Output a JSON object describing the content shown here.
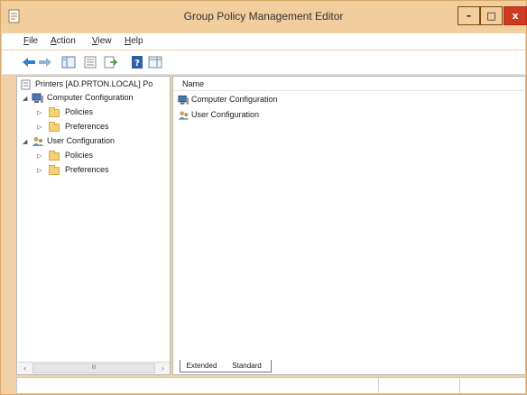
{
  "window": {
    "title": "Group Policy Management Editor",
    "controls": {
      "minimize": "–",
      "maximize": "□",
      "close": "x"
    },
    "accent_color": "#f2cd9e",
    "close_color": "#cc3a22"
  },
  "menu": {
    "items": [
      {
        "key": "F",
        "rest": "ile"
      },
      {
        "key": "A",
        "rest": "ction"
      },
      {
        "key": "V",
        "rest": "iew"
      },
      {
        "key": "H",
        "rest": "elp"
      }
    ]
  },
  "toolbar": {
    "buttons": [
      "back-arrow-icon",
      "forward-arrow-icon",
      "show-hide-tree-icon",
      "properties-icon",
      "export-list-icon",
      "help-icon",
      "show-action-pane-icon"
    ]
  },
  "tree": {
    "root": "Printers [AD.PRTON.LOCAL] Po",
    "computer_config": "Computer Configuration",
    "computer_policies": "Policies",
    "computer_preferences": "Preferences",
    "user_config": "User Configuration",
    "user_policies": "Policies",
    "user_preferences": "Preferences",
    "scroll_thumb": "III"
  },
  "list": {
    "column_name": "Name",
    "items": [
      "Computer Configuration",
      "User Configuration"
    ]
  },
  "tabs": {
    "extended": "Extended",
    "standard": "Standard"
  }
}
